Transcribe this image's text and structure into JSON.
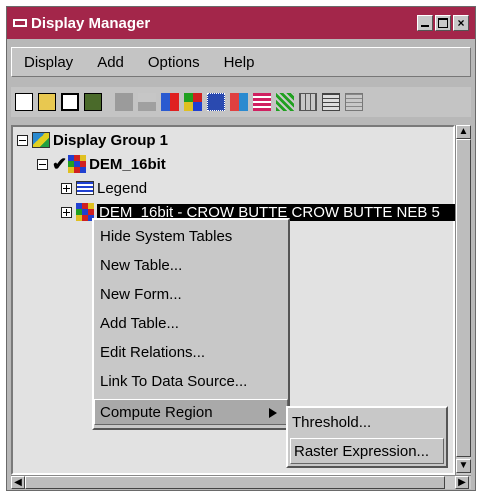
{
  "window": {
    "title": "Display Manager"
  },
  "menubar": {
    "items": [
      "Display",
      "Add",
      "Options",
      "Help"
    ]
  },
  "toolbar": {
    "icons": [
      "new-icon",
      "open-icon",
      "save-icon",
      "print-icon",
      "layer-icon",
      "vehicle-icon",
      "add-layer-icon",
      "raster-icon",
      "image-icon",
      "grid-icon",
      "table-icon",
      "network-icon",
      "legend-icon",
      "database-icon",
      "list-icon"
    ]
  },
  "tree": {
    "group": "Display Group 1",
    "layer": "DEM_16bit",
    "legend": "Legend",
    "selected_item": "DEM_16bit - CROW BUTTE CROW BUTTE NEB 5"
  },
  "context_menu": {
    "items": [
      "Hide System Tables",
      "New Table...",
      "New Form...",
      "Add Table...",
      "Edit Relations...",
      "Link To Data Source...",
      "Compute Region"
    ]
  },
  "submenu": {
    "items": [
      "Threshold...",
      "Raster Expression..."
    ]
  },
  "colors": {
    "titlebar": "#a3264a",
    "selection": "#000000",
    "menu": "#c8c8c8"
  }
}
